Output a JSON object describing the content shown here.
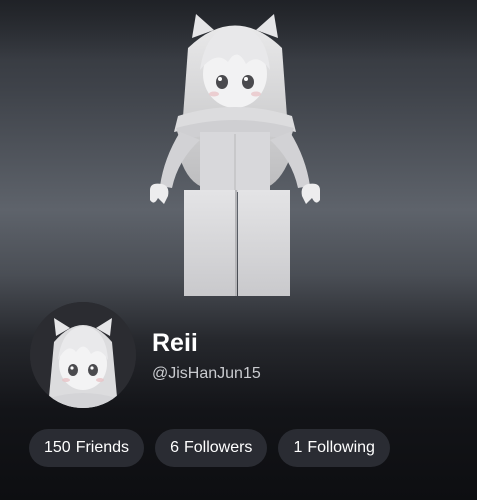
{
  "profile": {
    "display_name": "Reii",
    "username": "@JisHanJun15"
  },
  "stats": [
    {
      "count": "150",
      "label": "Friends"
    },
    {
      "count": "6",
      "label": "Followers"
    },
    {
      "count": "1",
      "label": "Following"
    }
  ],
  "colors": {
    "pill_background": "#2a2c33",
    "name_text": "#ffffff",
    "username_text": "#c9cbcf"
  }
}
